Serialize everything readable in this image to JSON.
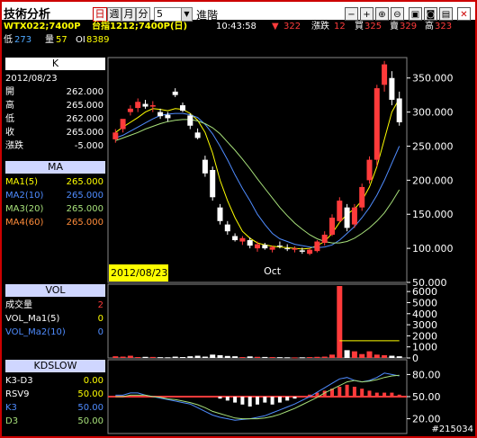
{
  "app": {
    "title": "技術分析"
  },
  "toolbar": {
    "period_buttons": [
      "日",
      "週",
      "月",
      "分"
    ],
    "active_period": "日",
    "interval_value": "5",
    "advanced_label": "進階",
    "tools": [
      "minus-icon",
      "plus-icon",
      "zoom-in-icon",
      "zoom-out-icon",
      "picture-icon",
      "save-icon",
      "print-icon",
      "close-icon"
    ]
  },
  "quote": {
    "symbol": "WTX022;7400P",
    "contract": "台指1212;7400P(日)",
    "time": "10:43:58",
    "change_arrow": "▼",
    "change_value": "322",
    "change_label": "漲跌",
    "change_amount": "12",
    "bid_label": "買",
    "bid_value": "325",
    "ask_label": "賣",
    "ask_value": "329",
    "high_label": "高",
    "high_value": "323",
    "low_label": "低",
    "low_value": "273",
    "volume_label": "量",
    "volume_value": "57",
    "oi_label": "OI",
    "oi_value": "8389"
  },
  "k_panel": {
    "header": "K",
    "date": "2012/08/23",
    "rows": [
      {
        "label": "開",
        "value": "262.000"
      },
      {
        "label": "高",
        "value": "265.000"
      },
      {
        "label": "低",
        "value": "262.000"
      },
      {
        "label": "收",
        "value": "265.000"
      },
      {
        "label": "漲跌",
        "value": "-5.000"
      }
    ]
  },
  "ma_panel": {
    "header": "MA",
    "rows": [
      {
        "label": "MA1(5)",
        "value": "265.000",
        "color": "#ffff00"
      },
      {
        "label": "MA2(10)",
        "value": "265.000",
        "color": "#4f8cff"
      },
      {
        "label": "MA3(20)",
        "value": "265.000",
        "color": "#a7e07a"
      },
      {
        "label": "MA4(60)",
        "value": "265.000",
        "color": "#ff8c3a"
      }
    ]
  },
  "vol_panel": {
    "header": "VOL",
    "rows": [
      {
        "label": "成交量",
        "value": "2"
      },
      {
        "label": "VOL_Ma1(5)",
        "value": "0"
      },
      {
        "label": "VOL_Ma2(10)",
        "value": "0"
      }
    ]
  },
  "kd_panel": {
    "header": "KDSLOW",
    "rows": [
      {
        "label": "K3-D3",
        "value": "0.00"
      },
      {
        "label": "RSV9",
        "value": "50.00"
      },
      {
        "label": "K3",
        "value": "50.00"
      },
      {
        "label": "D3",
        "value": "50.00"
      }
    ]
  },
  "chart": {
    "price_axis": [
      "350.000",
      "300.000",
      "250.000",
      "200.000",
      "150.000",
      "100.000",
      "50.000"
    ],
    "x_labels": [
      "2012/08/23",
      "Oct"
    ],
    "volume_axis": [
      "6000",
      "5000",
      "4000",
      "3000",
      "2000",
      "1000",
      "0"
    ],
    "kd_axis": [
      "80.00",
      "50.00",
      "20.00"
    ],
    "watermark": "#215034"
  },
  "colors": {
    "up": "#ff3b3b",
    "down": "#ffffff",
    "accent": "#c00000",
    "panel_head": "#cfd6ff",
    "axis": "#ffffff"
  },
  "chart_data": [
    {
      "type": "candlestick",
      "ylim": [
        50,
        380
      ],
      "xlabel": "",
      "ylabel": "",
      "candles": [
        {
          "o": 260,
          "h": 275,
          "l": 255,
          "c": 270
        },
        {
          "o": 275,
          "h": 285,
          "l": 270,
          "c": 290
        },
        {
          "o": 300,
          "h": 310,
          "l": 295,
          "c": 305
        },
        {
          "o": 306,
          "h": 320,
          "l": 300,
          "c": 315
        },
        {
          "o": 312,
          "h": 318,
          "l": 305,
          "c": 308
        },
        {
          "o": 308,
          "h": 316,
          "l": 300,
          "c": 310
        },
        {
          "o": 300,
          "h": 305,
          "l": 290,
          "c": 294
        },
        {
          "o": 296,
          "h": 300,
          "l": 286,
          "c": 291
        },
        {
          "o": 330,
          "h": 335,
          "l": 322,
          "c": 325
        },
        {
          "o": 310,
          "h": 314,
          "l": 300,
          "c": 302
        },
        {
          "o": 295,
          "h": 298,
          "l": 275,
          "c": 280
        },
        {
          "o": 270,
          "h": 276,
          "l": 260,
          "c": 262
        },
        {
          "o": 230,
          "h": 236,
          "l": 205,
          "c": 210
        },
        {
          "o": 215,
          "h": 220,
          "l": 170,
          "c": 175
        },
        {
          "o": 160,
          "h": 165,
          "l": 135,
          "c": 140
        },
        {
          "o": 135,
          "h": 140,
          "l": 120,
          "c": 125
        },
        {
          "o": 118,
          "h": 122,
          "l": 110,
          "c": 112
        },
        {
          "o": 110,
          "h": 118,
          "l": 105,
          "c": 115
        },
        {
          "o": 112,
          "h": 116,
          "l": 100,
          "c": 104
        },
        {
          "o": 100,
          "h": 110,
          "l": 95,
          "c": 106
        },
        {
          "o": 105,
          "h": 108,
          "l": 98,
          "c": 100
        },
        {
          "o": 98,
          "h": 104,
          "l": 94,
          "c": 102
        },
        {
          "o": 104,
          "h": 110,
          "l": 100,
          "c": 103
        },
        {
          "o": 100,
          "h": 106,
          "l": 96,
          "c": 99
        },
        {
          "o": 98,
          "h": 103,
          "l": 94,
          "c": 100
        },
        {
          "o": 97,
          "h": 101,
          "l": 92,
          "c": 95
        },
        {
          "o": 92,
          "h": 100,
          "l": 90,
          "c": 98
        },
        {
          "o": 96,
          "h": 112,
          "l": 94,
          "c": 110
        },
        {
          "o": 108,
          "h": 125,
          "l": 104,
          "c": 120
        },
        {
          "o": 120,
          "h": 150,
          "l": 118,
          "c": 145
        },
        {
          "o": 140,
          "h": 175,
          "l": 138,
          "c": 170
        },
        {
          "o": 160,
          "h": 165,
          "l": 125,
          "c": 130
        },
        {
          "o": 135,
          "h": 165,
          "l": 130,
          "c": 160
        },
        {
          "o": 160,
          "h": 195,
          "l": 155,
          "c": 190
        },
        {
          "o": 200,
          "h": 235,
          "l": 195,
          "c": 230
        },
        {
          "o": 230,
          "h": 340,
          "l": 220,
          "c": 335
        },
        {
          "o": 340,
          "h": 375,
          "l": 330,
          "c": 370
        },
        {
          "o": 350,
          "h": 360,
          "l": 310,
          "c": 318
        },
        {
          "o": 320,
          "h": 330,
          "l": 280,
          "c": 285
        }
      ],
      "series": [
        {
          "name": "MA1(5)",
          "values": [
            270,
            278,
            285,
            292,
            300,
            305,
            304,
            302,
            305,
            304,
            298,
            288,
            270,
            240,
            200,
            170,
            145,
            125,
            115,
            108,
            105,
            103,
            102,
            101,
            100,
            99,
            100,
            104,
            110,
            122,
            138,
            150,
            158,
            170,
            190,
            220,
            260,
            300,
            320
          ]
        },
        {
          "name": "MA2(10)",
          "values": [
            262,
            266,
            272,
            278,
            284,
            290,
            295,
            297,
            298,
            298,
            296,
            292,
            282,
            268,
            250,
            230,
            208,
            188,
            170,
            150,
            135,
            122,
            114,
            110,
            106,
            104,
            102,
            101,
            102,
            105,
            112,
            122,
            132,
            145,
            160,
            178,
            200,
            225,
            250
          ]
        },
        {
          "name": "MA3(20)",
          "values": [
            258,
            262,
            266,
            270,
            275,
            279,
            283,
            286,
            288,
            289,
            289,
            287,
            283,
            277,
            268,
            256,
            244,
            231,
            217,
            202,
            188,
            174,
            160,
            148,
            137,
            128,
            120,
            114,
            110,
            108,
            108,
            110,
            115,
            122,
            130,
            140,
            152,
            168,
            186
          ]
        }
      ]
    },
    {
      "type": "bar",
      "ylim": [
        0,
        6500
      ],
      "values": [
        150,
        120,
        200,
        80,
        100,
        90,
        70,
        60,
        120,
        80,
        150,
        200,
        120,
        300,
        250,
        180,
        150,
        80,
        140,
        100,
        90,
        80,
        70,
        60,
        50,
        60,
        80,
        100,
        120,
        300,
        6600,
        700,
        600,
        350,
        600,
        300,
        250,
        200,
        150
      ],
      "series": [
        {
          "name": "VOL_Ma1(5)",
          "values": [
            0,
            0,
            0,
            0,
            0,
            0,
            0,
            0,
            0,
            0,
            0,
            0,
            0,
            0,
            0,
            0,
            0,
            0,
            0,
            0,
            0,
            0,
            0,
            0,
            0,
            0,
            0,
            0,
            0,
            0,
            1550,
            1550,
            1550,
            1550,
            1550,
            1550,
            1550,
            1550,
            1550
          ]
        }
      ]
    },
    {
      "type": "bar",
      "ylim": [
        0,
        100
      ],
      "values": [
        0,
        0,
        0,
        0,
        0,
        0,
        0,
        0,
        0,
        0,
        0,
        0,
        0,
        0,
        -1,
        -2,
        -3,
        -4,
        -5,
        -4,
        -3,
        -4,
        -3,
        -2,
        -1,
        0,
        1,
        2,
        3,
        4,
        5,
        6,
        5,
        4,
        3,
        2,
        2,
        2,
        1
      ],
      "series": [
        {
          "name": "K3",
          "values": [
            52,
            52,
            55,
            55,
            52,
            50,
            48,
            46,
            44,
            42,
            40,
            35,
            30,
            25,
            22,
            20,
            18,
            19,
            20,
            22,
            24,
            28,
            32,
            36,
            40,
            45,
            50,
            56,
            62,
            68,
            74,
            76,
            72,
            70,
            72,
            76,
            82,
            80,
            78
          ]
        },
        {
          "name": "D3",
          "values": [
            50,
            50,
            52,
            52,
            52,
            50,
            49,
            47,
            46,
            44,
            42,
            39,
            35,
            30,
            27,
            24,
            21,
            20,
            20,
            20,
            21,
            23,
            26,
            30,
            34,
            39,
            44,
            49,
            55,
            60,
            65,
            70,
            72,
            70,
            71,
            73,
            76,
            78,
            79
          ]
        }
      ]
    }
  ]
}
